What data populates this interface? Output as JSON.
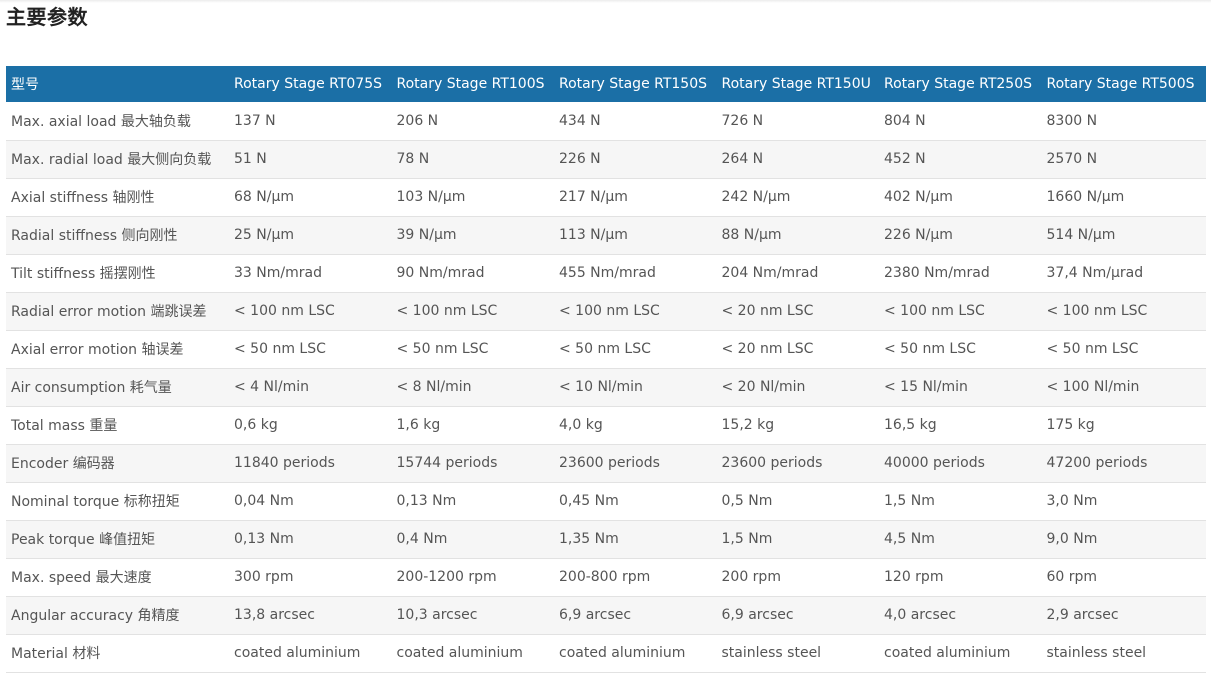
{
  "heading": "主要参数",
  "table": {
    "header": {
      "label": "型号",
      "models": [
        "Rotary Stage RT075S",
        "Rotary Stage RT100S",
        "Rotary Stage RT150S",
        "Rotary Stage RT150U",
        "Rotary Stage RT250S",
        "Rotary Stage RT500S"
      ]
    },
    "rows": [
      {
        "label": "Max. axial load 最大轴负载",
        "values": [
          "137 N",
          "206 N",
          "434 N",
          "726 N",
          "804 N",
          "8300 N"
        ]
      },
      {
        "label": "Max. radial load 最大侧向负载",
        "values": [
          "51 N",
          "78 N",
          "226 N",
          "264 N",
          "452 N",
          "2570 N"
        ]
      },
      {
        "label": "Axial stiffness 轴刚性",
        "values": [
          "68 N/µm",
          "103 N/µm",
          "217 N/µm",
          "242 N/µm",
          "402 N/µm",
          "1660 N/µm"
        ]
      },
      {
        "label": "Radial stiffness 侧向刚性",
        "values": [
          "25 N/µm",
          "39 N/µm",
          "113 N/µm",
          "88 N/µm",
          "226 N/µm",
          "514 N/µm"
        ]
      },
      {
        "label": "Tilt stiffness 摇摆刚性",
        "values": [
          "33 Nm/mrad",
          "90 Nm/mrad",
          "455 Nm/mrad",
          "204 Nm/mrad",
          "2380 Nm/mrad",
          "37,4 Nm/µrad"
        ]
      },
      {
        "label": "Radial error motion 端跳误差",
        "values": [
          "< 100 nm LSC",
          "< 100 nm LSC",
          "< 100 nm LSC",
          "< 20 nm LSC",
          "< 100 nm LSC",
          "< 100 nm LSC"
        ]
      },
      {
        "label": "Axial error motion 轴误差",
        "values": [
          "< 50 nm LSC",
          "< 50 nm LSC",
          "< 50 nm LSC",
          "< 20 nm LSC",
          "< 50 nm LSC",
          "< 50 nm LSC"
        ]
      },
      {
        "label": "Air consumption 耗气量",
        "values": [
          "< 4 Nl/min",
          "< 8 Nl/min",
          "< 10 Nl/min",
          "< 20 Nl/min",
          "< 15 Nl/min",
          "< 100 Nl/min"
        ]
      },
      {
        "label": "Total mass 重量",
        "values": [
          "0,6 kg",
          "1,6 kg",
          "4,0 kg",
          "15,2 kg",
          "16,5 kg",
          "175 kg"
        ]
      },
      {
        "label": "Encoder 编码器",
        "values": [
          "11840 periods",
          "15744 periods",
          "23600 periods",
          "23600 periods",
          "40000 periods",
          "47200 periods"
        ]
      },
      {
        "label": "Nominal torque 标称扭矩",
        "values": [
          "0,04 Nm",
          "0,13 Nm",
          "0,45 Nm",
          "0,5 Nm",
          "1,5 Nm",
          "3,0 Nm"
        ]
      },
      {
        "label": "Peak torque 峰值扭矩",
        "values": [
          "0,13 Nm",
          "0,4 Nm",
          "1,35 Nm",
          "1,5 Nm",
          "4,5 Nm",
          "9,0 Nm"
        ]
      },
      {
        "label": "Max. speed 最大速度",
        "values": [
          "300 rpm",
          "200-1200 rpm",
          "200-800 rpm",
          "200 rpm",
          "120 rpm",
          "60 rpm"
        ]
      },
      {
        "label": "Angular accuracy 角精度",
        "values": [
          "13,8 arcsec",
          "10,3 arcsec",
          "6,9 arcsec",
          "6,9 arcsec",
          "4,0 arcsec",
          "2,9 arcsec"
        ]
      },
      {
        "label": "Material 材料",
        "values": [
          "coated aluminium",
          "coated aluminium",
          "coated aluminium",
          "stainless steel",
          "coated aluminium",
          "stainless steel"
        ]
      }
    ]
  },
  "colors": {
    "header_background": "#1b6fa6",
    "header_text": "#ffffff",
    "row_stripe": "#f6f6f6",
    "body_text": "#555555"
  }
}
